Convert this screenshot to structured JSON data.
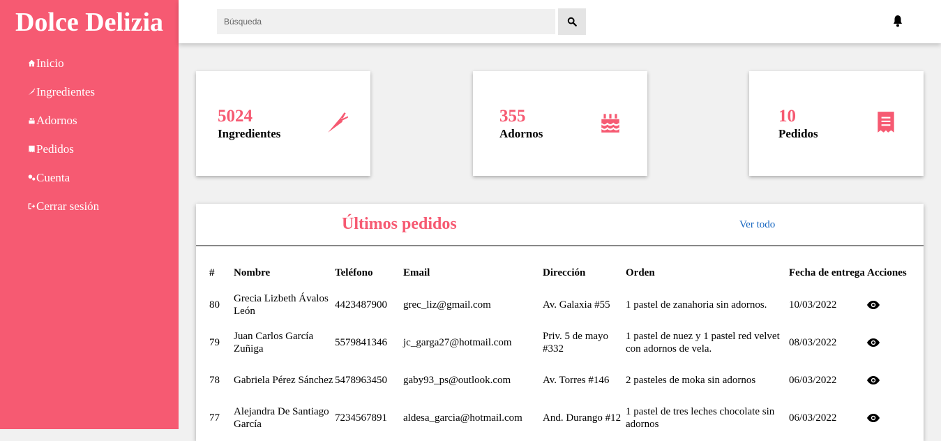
{
  "brand": "Dolce Delizia",
  "sidebar": {
    "items": [
      {
        "label": "Inicio",
        "icon": "home-icon"
      },
      {
        "label": "Ingredientes",
        "icon": "carrot-icon"
      },
      {
        "label": "Adornos",
        "icon": "cake-icon"
      },
      {
        "label": "Pedidos",
        "icon": "receipt-icon"
      },
      {
        "label": "Cuenta",
        "icon": "gears-icon"
      },
      {
        "label": "Cerrar sesión",
        "icon": "sign-out-icon"
      }
    ]
  },
  "search": {
    "placeholder": "Búsqueda",
    "value": ""
  },
  "cards": [
    {
      "value": "5024",
      "label": "Ingredientes",
      "icon": "carrot-icon"
    },
    {
      "value": "355",
      "label": "Adornos",
      "icon": "birthday-cake-icon"
    },
    {
      "value": "10",
      "label": "Pedidos",
      "icon": "receipt-icon"
    }
  ],
  "orders": {
    "title": "Últimos pedidos",
    "view_all": "Ver todo",
    "columns": [
      "#",
      "Nombre",
      "Teléfono",
      "Email",
      "Dirección",
      "Orden",
      "Fecha de entrega",
      "Acciones"
    ],
    "rows": [
      {
        "id": "80",
        "name": "Grecia Lizbeth Ávalos León",
        "phone": "4423487900",
        "email": "grec_liz@gmail.com",
        "address": "Av. Galaxia #55",
        "order": "1 pastel de zanahoria sin adornos.",
        "date": "10/03/2022"
      },
      {
        "id": "79",
        "name": "Juan Carlos García Zuñiga",
        "phone": "5579841346",
        "email": "jc_garga27@hotmail.com",
        "address": "Priv. 5 de mayo #332",
        "order": "1 pastel de nuez y 1 pastel red velvet con adornos de vela.",
        "date": "08/03/2022"
      },
      {
        "id": "78",
        "name": "Gabriela Pérez Sánchez",
        "phone": "5478963450",
        "email": "gaby93_ps@outlook.com",
        "address": "Av. Torres #146",
        "order": "2 pasteles de moka sin adornos",
        "date": "06/03/2022"
      },
      {
        "id": "77",
        "name": "Alejandra De Santiago García",
        "phone": "7234567891",
        "email": "aldesa_garcia@hotmail.com",
        "address": "And. Durango #12",
        "order": "1 pastel de tres leches chocolate sin adornos",
        "date": "06/03/2022"
      }
    ]
  },
  "colors": {
    "accent": "#f65a72",
    "link": "#1565c0"
  }
}
